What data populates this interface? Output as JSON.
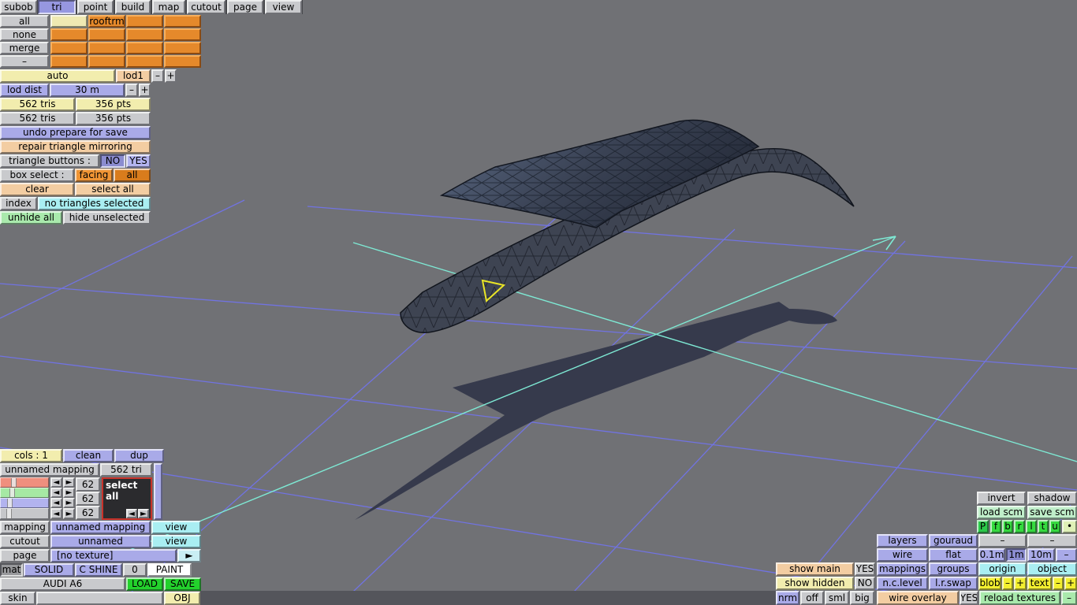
{
  "menu": {
    "items": [
      "subob",
      "tri",
      "point",
      "build",
      "map",
      "cutout",
      "page",
      "view"
    ],
    "selected": "tri"
  },
  "subobjects": {
    "buttons": [
      "all",
      "none",
      "merge",
      "–"
    ],
    "grid_label": "rooftrm"
  },
  "lod": {
    "auto": "auto",
    "level": "lod1",
    "minus": "–",
    "plus": "+",
    "dist_label": "lod dist",
    "dist_value": "30 m",
    "stats": [
      [
        "562 tris",
        "356 pts"
      ],
      [
        "562 tris",
        "356 pts"
      ]
    ]
  },
  "tools": {
    "undo": "undo prepare for save",
    "repair": "repair triangle mirroring",
    "tri_buttons_label": "triangle buttons :",
    "no": "NO",
    "yes": "YES",
    "box_select_label": "box select :",
    "facing": "facing",
    "all": "all",
    "clear": "clear",
    "select_all": "select all",
    "index": "index",
    "selection_status": "no triangles selected",
    "unhide_all": "unhide all",
    "hide_unselected": "hide unselected"
  },
  "colors_panel": {
    "cols": "cols : 1",
    "clean": "clean",
    "dup": "dup",
    "mapping_name": "unnamed mapping",
    "tri_count": "562 tri",
    "channel_values": [
      "62",
      "62",
      "62"
    ],
    "select_all": "select all",
    "arrow_left": "◄",
    "arrow_right": "►"
  },
  "mapping_panel": {
    "rows": [
      {
        "label": "mapping",
        "value": "unnamed mapping",
        "action": "view"
      },
      {
        "label": "cutout",
        "value": "unnamed",
        "action": "view"
      },
      {
        "label": "page",
        "value": "[no texture]",
        "action": "►"
      }
    ],
    "mat_label": "mat",
    "mat_type": "SOLID",
    "mat_shine": "C SHINE",
    "mat_num": "0",
    "mat_paint": "PAINT",
    "model_name": "AUDI A6",
    "load": "LOAD",
    "save": "SAVE",
    "skin": "skin",
    "obj": "OBJ"
  },
  "right_panel": {
    "invert": "invert",
    "shadow": "shadow",
    "load_scm": "load scm",
    "save_scm": "save scm",
    "letters": [
      "P",
      "f",
      "b",
      "r",
      "l",
      "t",
      "u",
      "•"
    ],
    "layers": "layers",
    "gouraud": "gouraud",
    "dash_a": "–",
    "dash_b": "–",
    "wire": "wire",
    "flat": "flat",
    "m01": "0.1m",
    "m1": "1m",
    "m10": "10m",
    "mdash": "–",
    "show_main": "show main",
    "show_main_val": "YES",
    "mappings": "mappings",
    "groups": "groups",
    "origin": "origin",
    "object": "object",
    "show_hidden": "show hidden",
    "show_hidden_val": "NO",
    "nclevel": "n.c.level",
    "lrswap": "l.r.swap",
    "blob": "blob",
    "blob_minus": "–",
    "blob_plus": "+",
    "text": "text",
    "text_minus": "–",
    "text_plus": "+",
    "nrm": "nrm",
    "off": "off",
    "sml": "sml",
    "big": "big",
    "wire_overlay": "wire overlay",
    "wire_overlay_val": "YES",
    "reload_textures": "reload textures",
    "reload_dash": "–"
  },
  "viewport": {
    "colors": {
      "background": "#707175",
      "grid": "#7173e2",
      "axis": "#7ee9d4",
      "shadow": "#363a4c",
      "mesh_fill": "#3e4452",
      "selection": "#e9e427"
    }
  }
}
